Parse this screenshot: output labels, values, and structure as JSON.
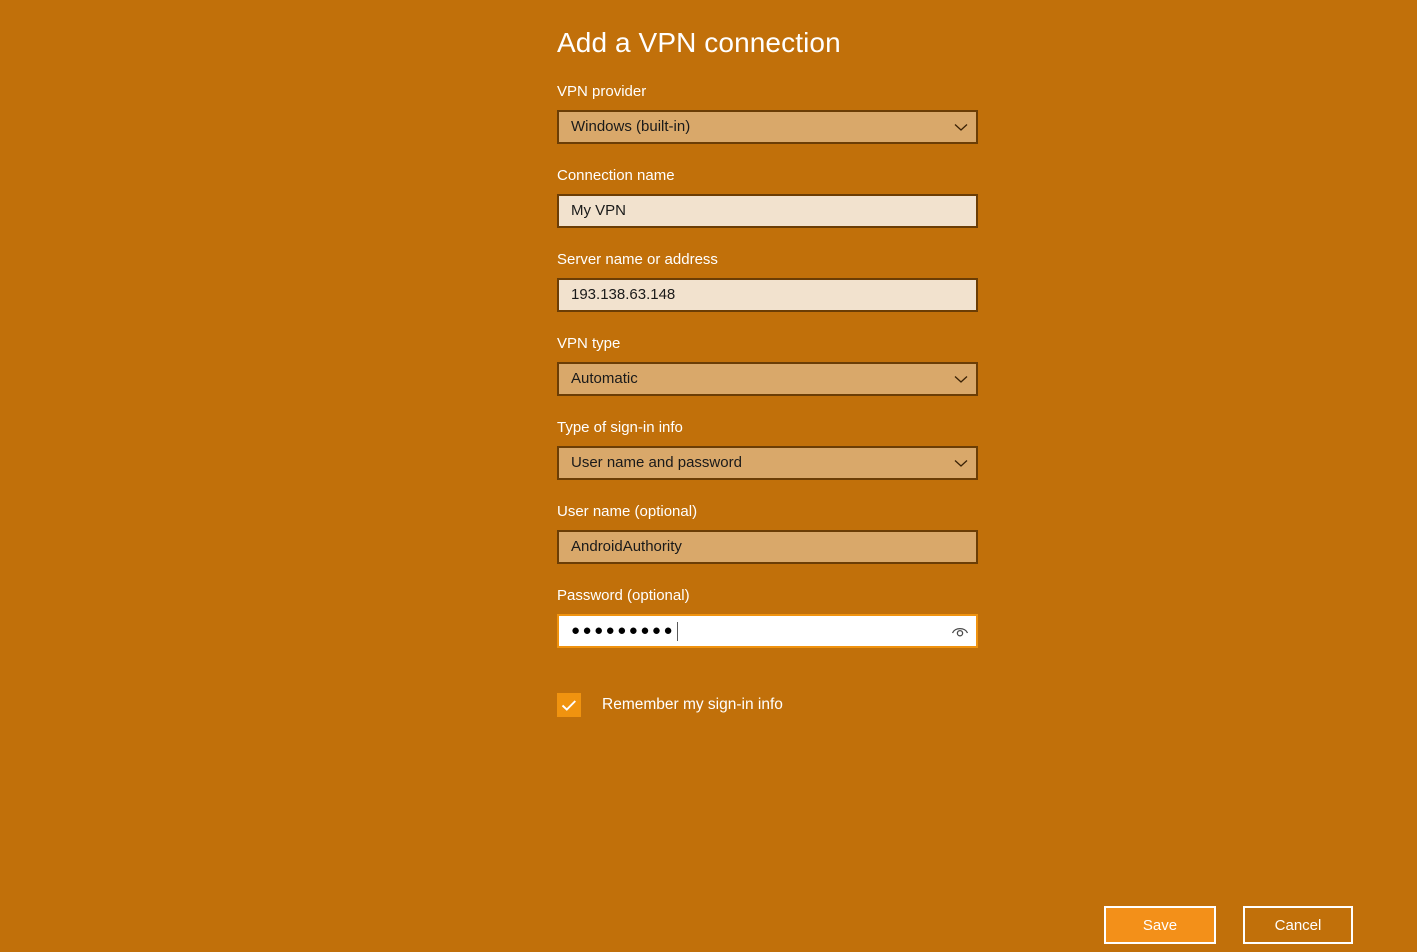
{
  "dialog": {
    "title": "Add a VPN connection",
    "fields": [
      {
        "label": "VPN provider",
        "value": "Windows (built-in)",
        "kind": "select"
      },
      {
        "label": "Connection name",
        "value": "My VPN",
        "kind": "textbox"
      },
      {
        "label": "Server name or address",
        "value": "193.138.63.148",
        "kind": "textbox"
      },
      {
        "label": "VPN type",
        "value": "Automatic",
        "kind": "select"
      },
      {
        "label": "Type of sign-in info",
        "value": "User name and password",
        "kind": "select"
      },
      {
        "label": "User name (optional)",
        "value": "AndroidAuthority",
        "kind": "username"
      },
      {
        "label": "Password (optional)",
        "value": "●●●●●●●●●",
        "kind": "password"
      }
    ],
    "remember_checkbox": {
      "label": "Remember my sign-in info",
      "checked": "true"
    },
    "buttons": {
      "save": "Save",
      "cancel": "Cancel"
    },
    "icons": {
      "chevron": "chevron-down-icon",
      "reveal": "eye-reveal-password-icon",
      "check": "checkmark-icon"
    },
    "colors": {
      "background": "#C1700A",
      "accent": "#F0930F",
      "field_border": "#6B3D05",
      "select_fill": "#D9A86A",
      "textbox_fill": "#F2E2CE",
      "focused_fill": "#FFFFFF",
      "text_light": "#FFFFFF",
      "text_dark": "#1A1A1A"
    }
  }
}
